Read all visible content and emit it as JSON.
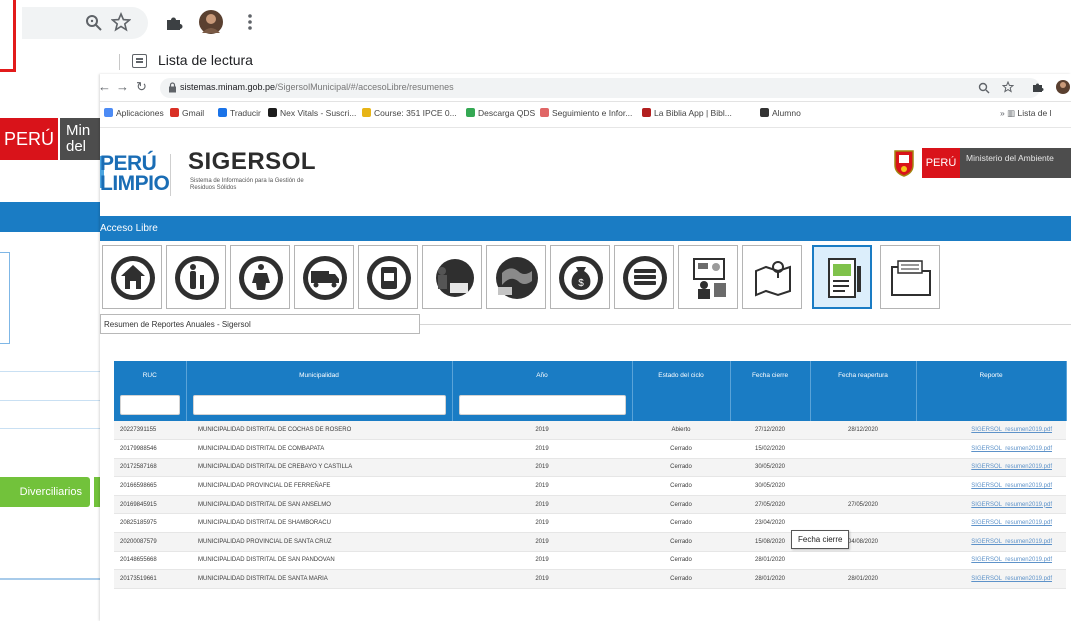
{
  "background_window": {
    "toolbar_icons": [
      "search-icon",
      "star-icon",
      "puzzle-icon",
      "avatar",
      "menu-dots-icon"
    ],
    "reading_list_label": "Lista de lectura",
    "peru_badge": "PERÚ",
    "ministry_label": "Min del",
    "green_button_label": "Diverciliarios"
  },
  "browser": {
    "url_host": "sistemas.minam.gob.pe",
    "url_path": "/SigersolMunicipal/#/accesoLibre/resumenes",
    "bookmarks": [
      {
        "label": "Aplicaciones",
        "color": "#4c8bf5"
      },
      {
        "label": "Gmail",
        "color": "#d93025"
      },
      {
        "label": "Traducir",
        "color": "#1a73e8"
      },
      {
        "label": "Nex Vitals - Suscri...",
        "color": "#1c1c1c"
      },
      {
        "label": "Course: 351 IPCE 0...",
        "color": "#e7b416"
      },
      {
        "label": "Descarga QDS",
        "color": "#34a853"
      },
      {
        "label": "Seguimiento e Infor...",
        "color": "#e06666"
      },
      {
        "label": "La Biblia App | Bibl...",
        "color": "#b21f1f"
      },
      {
        "label": "Alumno",
        "color": "#333333"
      }
    ],
    "reading_list_short": "Lista de l"
  },
  "header": {
    "logo_line1": "PERÚ",
    "logo_line2": "LIMPIO",
    "app_title": "SIGERSOL",
    "app_subtitle": "Sistema de Información para la Gestión de Residuos Sólidos",
    "peru_badge": "PERÚ",
    "ministry": "Ministerio del Ambiente"
  },
  "access_bar": {
    "label": "Acceso Libre"
  },
  "modules": [
    {
      "icon": "house-icon",
      "active": false
    },
    {
      "icon": "people-icon",
      "active": false
    },
    {
      "icon": "recycle-person-icon",
      "active": false
    },
    {
      "icon": "truck-icon",
      "active": false
    },
    {
      "icon": "bin-icon",
      "active": false
    },
    {
      "icon": "worker-icon",
      "active": false
    },
    {
      "icon": "globe-icon",
      "active": false
    },
    {
      "icon": "money-bag-icon",
      "active": false
    },
    {
      "icon": "stack-icon",
      "active": false
    },
    {
      "icon": "presentation-icon",
      "active": false
    },
    {
      "icon": "map-icon",
      "active": true
    },
    {
      "icon": "report-icon",
      "active": false
    },
    {
      "icon": "folder-icon",
      "active": false
    }
  ],
  "section_title": "Resumen de Reportes Anuales - Sigersol",
  "table": {
    "columns": [
      "RUC",
      "Municipalidad",
      "Año",
      "Estado del ciclo",
      "Fecha cierre",
      "Fecha reapertura",
      "Reporte"
    ],
    "rows": [
      [
        "20227391155",
        "MUNICIPALIDAD DISTRITAL DE COCHAS DE ROSERO",
        "2019",
        "Abierto",
        "27/12/2020",
        "28/12/2020",
        "SIGERSOL_resumen2019.pdf"
      ],
      [
        "20179988546",
        "MUNICIPALIDAD DISTRITAL DE COMBAPATA",
        "2019",
        "Cerrado",
        "15/02/2020",
        "",
        "SIGERSOL_resumen2019.pdf"
      ],
      [
        "20172587168",
        "MUNICIPALIDAD DISTRITAL DE CREBAYO Y CASTILLA",
        "2019",
        "Cerrado",
        "30/05/2020",
        "",
        "SIGERSOL_resumen2019.pdf"
      ],
      [
        "20166598665",
        "MUNICIPALIDAD PROVINCIAL DE FERREÑAFE",
        "2019",
        "Cerrado",
        "30/05/2020",
        "",
        "SIGERSOL_resumen2019.pdf"
      ],
      [
        "20169845915",
        "MUNICIPALIDAD DISTRITAL DE SAN ANSELMO",
        "2019",
        "Cerrado",
        "27/05/2020",
        "27/05/2020",
        "SIGERSOL_resumen2019.pdf"
      ],
      [
        "20825185975",
        "MUNICIPALIDAD DISTRITAL DE SHAMBORACU",
        "2019",
        "Cerrado",
        "23/04/2020",
        "",
        "SIGERSOL_resumen2019.pdf"
      ],
      [
        "20200087579",
        "MUNICIPALIDAD PROVINCIAL DE SANTA CRUZ",
        "2019",
        "Cerrado",
        "15/08/2020",
        "04/08/2020",
        "SIGERSOL_resumen2019.pdf"
      ],
      [
        "20148655668",
        "MUNICIPALIDAD DISTRITAL DE SAN PANDOVAN",
        "2019",
        "Cerrado",
        "28/01/2020",
        "",
        "SIGERSOL_resumen2019.pdf"
      ],
      [
        "20173519661",
        "MUNICIPALIDAD DISTRITAL DE SANTA MARIA",
        "2019",
        "Cerrado",
        "28/01/2020",
        "28/01/2020",
        "SIGERSOL_resumen2019.pdf"
      ]
    ]
  },
  "hover_tooltip": "Fecha cierre",
  "colors": {
    "primary_blue": "#1a7cc4",
    "peru_red": "#d9131a",
    "minam_grey": "#4d4d4d",
    "link_blue": "#5d92c9"
  }
}
